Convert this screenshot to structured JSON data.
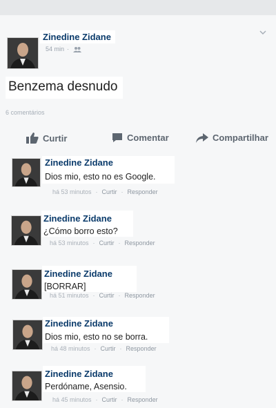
{
  "post": {
    "author": "Zinedine Zidane",
    "time": "54 min",
    "meta_sep": "·",
    "status_text": "Benzema desnudo",
    "comments_count": "6 comentários"
  },
  "actions": {
    "like": "Curtir",
    "comment": "Comentar",
    "share": "Compartilhar"
  },
  "comments": [
    {
      "author": "Zinedine Zidane",
      "text": "Dios mio, esto no es Google.",
      "time": "há 53 minutos",
      "like": "Curtir",
      "reply": "Responder"
    },
    {
      "author": "Zinedine Zidane",
      "text": "¿Cómo borro esto?",
      "time": "há 53 minutos",
      "like": "Curtir",
      "reply": "Responder"
    },
    {
      "author": "Zinedine Zidane",
      "text": "[BORRAR]",
      "time": "há 51 minutos",
      "like": "Curtir",
      "reply": "Responder"
    },
    {
      "author": "Zinedine Zidane",
      "text": "Dios mio, esto no se borra.",
      "time": "há 48 minutos",
      "like": "Curtir",
      "reply": "Responder"
    },
    {
      "author": "Zinedine Zidane",
      "text": "Perdóname, Asensio.",
      "time": "há 45 minutos",
      "like": "Curtir",
      "reply": "Responder"
    }
  ],
  "meta_dot": "·",
  "colors": {
    "link_blue": "#0b3b6b",
    "muted": "#9aa3ad",
    "action": "#5d6670"
  },
  "icons": [
    "friends-icon",
    "chevron-down-icon",
    "like-icon",
    "comment-icon",
    "share-icon"
  ]
}
